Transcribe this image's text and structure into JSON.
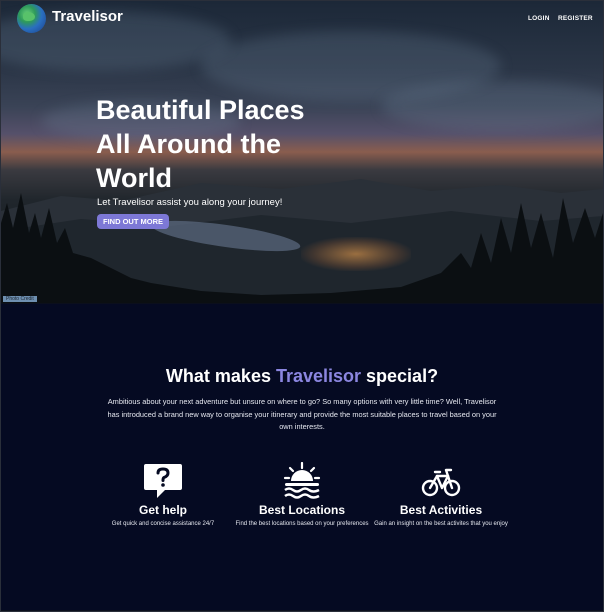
{
  "nav": {
    "brand": "Travelisor",
    "login": "LOGIN",
    "register": "REGISTER"
  },
  "hero": {
    "title_line1": "Beautiful Places",
    "title_line2": "All Around the",
    "title_line3": "World",
    "subtitle": "Let Travelisor assist you along your journey!",
    "cta": "FIND OUT MORE",
    "credit": "Photo Credit"
  },
  "about": {
    "title_prefix": "What makes ",
    "title_accent": "Travelisor",
    "title_suffix": " special?",
    "description": "Ambitious about your next adventure but unsure on where to go? So many options with very little time? Well, Travelisor has introduced a brand new way to organise your itinerary and provide the most suitable places to travel based on your own interests.",
    "accent_color": "#8b86e0"
  },
  "features": [
    {
      "icon": "question-bubble-icon",
      "title": "Get help",
      "desc": "Get quick and concise assistance 24/7"
    },
    {
      "icon": "sunset-icon",
      "title": "Best Locations",
      "desc": "Find the best locations based on your preferences"
    },
    {
      "icon": "bicycle-icon",
      "title": "Best Activities",
      "desc": "Gain an insight on the best activites that you enjoy"
    }
  ]
}
